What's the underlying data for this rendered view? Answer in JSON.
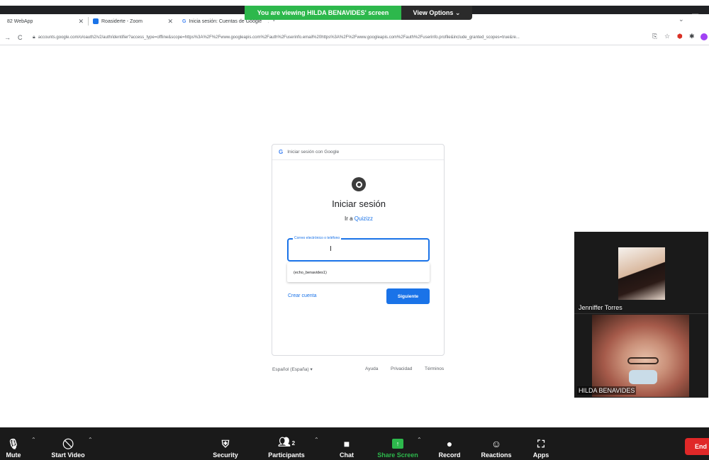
{
  "browser": {
    "tabs": [
      {
        "label": "82 WebApp"
      },
      {
        "label": "Roasiderte - Zoom"
      },
      {
        "label": "Inicia sesión: Cuentas de Google"
      }
    ],
    "url": "accounts.google.com/o/oauth2/v2/auth/identifier?access_type=offline&scope=https%3A%2F%2Fwww.googleapis.com%2Fauth%2Fuserinfo.email%20https%3A%2F%2Fwww.googleapis.com%2Fauth%2Fuserinfo.profile&include_granted_scopes=true&re..."
  },
  "share_banner": {
    "text": "You are viewing HILDA BENAVIDES' screen",
    "view_options": "View Options ⌄"
  },
  "google": {
    "header": "Iniciar sesión con Google",
    "title": "Iniciar sesión",
    "subtitle_prefix": "Ir a ",
    "app_name": "Quizizz",
    "email_label": "Correo electrónico o teléfono",
    "suggestion": "(echo_benavides1)",
    "create_account": "Crear cuenta",
    "next": "Siguiente"
  },
  "footer": {
    "language": "Español (España) ▾",
    "help": "Ayuda",
    "privacy": "Privacidad",
    "terms": "Términos"
  },
  "participants": [
    {
      "name": "Jenniffer Torres"
    },
    {
      "name": "HILDA BENAVIDES"
    }
  ],
  "toolbar": {
    "mute": "Mute",
    "start_video": "Start Video",
    "security": "Security",
    "participants": "Participants",
    "participants_count": "2",
    "chat": "Chat",
    "share_screen": "Share Screen",
    "record": "Record",
    "reactions": "Reactions",
    "apps": "Apps",
    "end": "End"
  },
  "colors": {
    "zoom_green": "#2db84c",
    "google_blue": "#1a73e8",
    "zoom_toolbar": "#1a1a1a",
    "end_red": "#e02828"
  }
}
